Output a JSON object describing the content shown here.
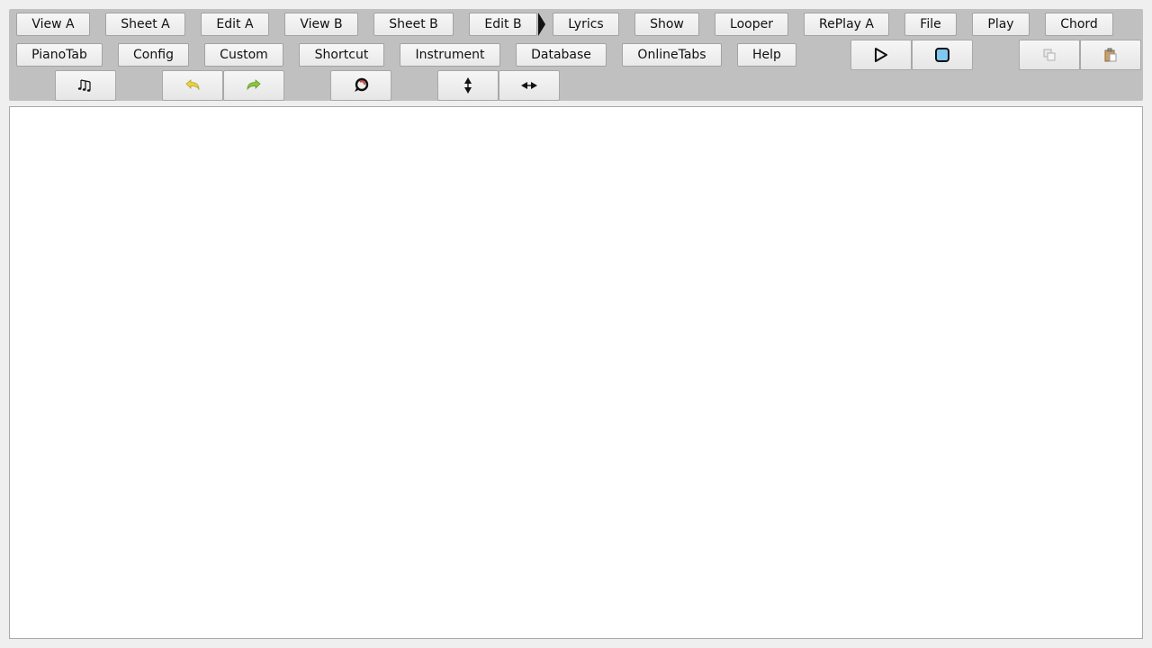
{
  "tabs_row1": [
    "View A",
    "Sheet A",
    "Edit A",
    "View B",
    "Sheet B",
    "Edit B",
    "Lyrics",
    "Show",
    "Looper",
    "RePlay A",
    "File",
    "Play",
    "Chord"
  ],
  "tabs_row2": [
    "PianoTab",
    "Config",
    "Custom",
    "Shortcut",
    "Instrument",
    "Database",
    "OnlineTabs",
    "Help"
  ],
  "icons": {
    "play": "play-icon",
    "stop": "stop-icon",
    "copy": "copy-icon",
    "paste": "paste-icon",
    "notes": "notes-icon",
    "undo": "undo-icon",
    "redo": "redo-icon",
    "loop": "loop-icon",
    "expand_vertical": "vertical-arrows-icon",
    "expand_horizontal": "horizontal-arrows-icon"
  },
  "colors": {
    "toolbar_bg": "#c0c0c0",
    "undo_yellow": "#e8d24a",
    "redo_green": "#8cc63f",
    "stop_blue": "#7ec8f2",
    "loop_red": "#e04040"
  }
}
